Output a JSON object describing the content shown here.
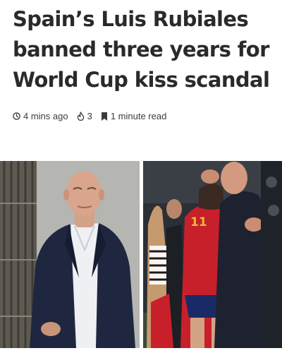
{
  "article": {
    "headline": "Spain’s Luis Rubiales banned three years for World Cup kiss scandal"
  },
  "meta": {
    "time": "4 mins ago",
    "time_icon": "clock-icon",
    "views": "3",
    "views_icon": "flame-icon",
    "read_time": "1 minute read",
    "read_icon": "bookmark-icon"
  },
  "image": {
    "jersey_number": "11",
    "colors": {
      "jersey_red": "#c8202a",
      "suit_navy": "#1f2740",
      "jersey_number_gold": "#e8b93a"
    }
  }
}
